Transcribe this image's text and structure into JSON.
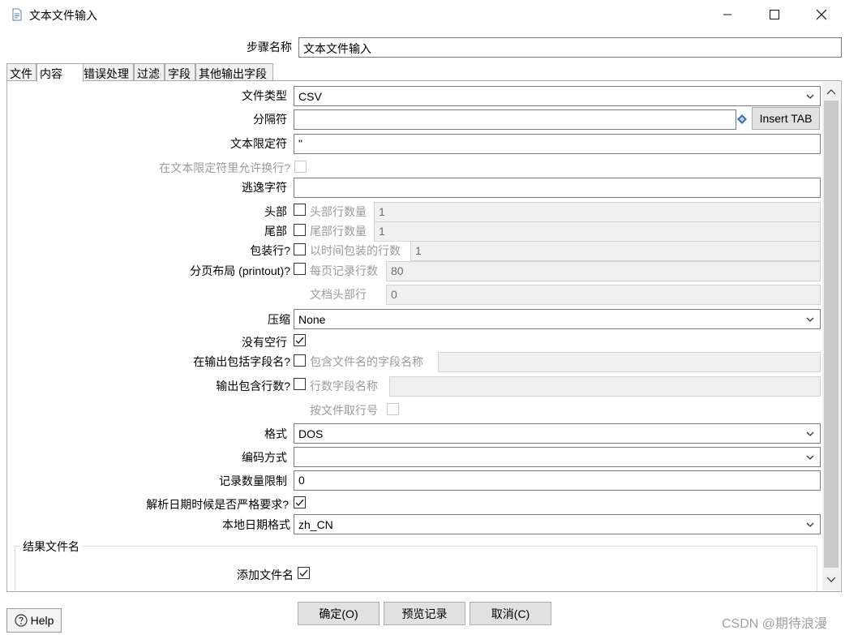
{
  "window": {
    "title": "文本文件输入"
  },
  "step": {
    "label": "步骤名称",
    "value": "文本文件输入"
  },
  "tabs": [
    "文件",
    "内容",
    "错误处理",
    "过滤",
    "字段",
    "其他输出字段"
  ],
  "active_tab": "内容",
  "form": {
    "file_type": {
      "label": "文件类型",
      "value": "CSV"
    },
    "separator": {
      "label": "分隔符",
      "value": "",
      "insert_tab": "Insert TAB"
    },
    "enclosure": {
      "label": "文本限定符",
      "value": "\""
    },
    "allow_breaks": {
      "label": "在文本限定符里允许换行?"
    },
    "escape": {
      "label": "逃逸字符",
      "value": ""
    },
    "header": {
      "label": "头部",
      "sub_label": "头部行数量",
      "value": "1"
    },
    "footer": {
      "label": "尾部",
      "sub_label": "尾部行数量",
      "value": "1"
    },
    "wrapped": {
      "label": "包装行?",
      "sub_label": "以时间包装的行数",
      "value": "1"
    },
    "layout_paged": {
      "label": "分页布局 (printout)?",
      "sub_label": "每页记录行数",
      "value": "80"
    },
    "doc_header": {
      "label": "文档头部行",
      "value": "0"
    },
    "compression": {
      "label": "压缩",
      "value": "None"
    },
    "no_empty_rows": {
      "label": "没有空行",
      "checked": true
    },
    "include_filename": {
      "label": "在输出包括字段名?",
      "sub_label": "包含文件名的字段名称",
      "value": ""
    },
    "rownum": {
      "label": "输出包含行数?",
      "sub_label": "行数字段名称",
      "value": ""
    },
    "rownum_per_file": {
      "label": "按文件取行号"
    },
    "format": {
      "label": "格式",
      "value": "DOS"
    },
    "encoding": {
      "label": "编码方式",
      "value": ""
    },
    "limit": {
      "label": "记录数量限制",
      "value": "0"
    },
    "lenient_dates": {
      "label": "解析日期时候是否严格要求?",
      "checked": true
    },
    "date_locale": {
      "label": "本地日期格式",
      "value": "zh_CN"
    }
  },
  "result_group": {
    "title": "结果文件名",
    "add_filename_label": "添加文件名",
    "add_filename_checked": true
  },
  "buttons": {
    "help": "Help",
    "ok": "确定(O)",
    "preview": "预览记录",
    "cancel": "取消(C)"
  },
  "watermark": "CSDN @期待浪漫"
}
